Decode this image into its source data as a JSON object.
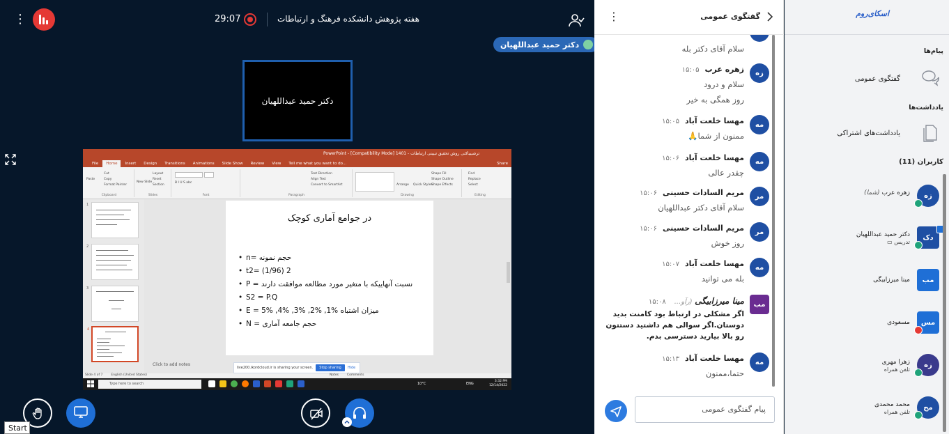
{
  "stage": {
    "timer": "29:07",
    "meeting_title": "هفته پژوهش دانشکده فرهنگ و ارتباطات",
    "speaker_pill": "دکتر حمید عبداللهیان",
    "camera_tile_name": "دکتر حمید عبداللهیان",
    "tooltip": "Start",
    "colors": {
      "background": "#06172a",
      "accent_red": "#e53935",
      "accent_blue": "#1f6fd6"
    }
  },
  "screen_share": {
    "ppt_title": "ترشیبیاکنی روش تحقیق تبیینی ارتباطات - 1401 [Compatibility Mode] - PowerPoint",
    "tabs": [
      "File",
      "Home",
      "Insert",
      "Design",
      "Transitions",
      "Animations",
      "Slide Show",
      "Review",
      "View",
      "Tell me what you want to do..."
    ],
    "share_label": "Share",
    "ribbon": {
      "clipboard": [
        "Cut",
        "Copy",
        "Format Painter",
        "Paste"
      ],
      "slides": [
        "New Slide",
        "Layout",
        "Reset",
        "Section"
      ],
      "group_labels": [
        "Clipboard",
        "Slides",
        "Font",
        "Paragraph",
        "Drawing",
        "Editing"
      ],
      "paragraph_items": [
        "Text Direction",
        "Align Text",
        "Convert to SmartArt"
      ],
      "drawing_items": [
        "Arrange",
        "Quick Styles",
        "Shape Fill",
        "Shape Outline",
        "Shape Effects"
      ],
      "editing_items": [
        "Find",
        "Replace",
        "Select"
      ]
    },
    "slide_numbers": [
      "1",
      "2",
      "3",
      "4"
    ],
    "slide": {
      "title": "در جوامع آماری کوچک",
      "bullets": [
        "n= حجم نمونه",
        "t2= (1/96) 2",
        "P = نسبت آنهاییکه با متغیر مورد مطالعه موافقت دارند",
        "S2 = P.Q",
        "E = میزان اشتباه %1, %2, %3, %4, %5",
        "N = حجم جامعه آماری"
      ]
    },
    "notes_placeholder": "Click to add notes",
    "sharing_bar": {
      "text": "live200.ikordcloud.ir is sharing your screen.",
      "stop_label": "Stop sharing",
      "hide_label": "Hide"
    },
    "status_bar": {
      "slide_info": "Slide 4 of 7",
      "language": "English (United States)",
      "notes": "Notes",
      "comments": "Comments"
    },
    "taskbar": {
      "search_placeholder": "Type here to search",
      "temperature": "10°C",
      "lang": "ENG",
      "time": "3:32 PM",
      "date": "12/14/2022"
    }
  },
  "chat": {
    "title": "گفتگوی عمومی",
    "messages": [
      {
        "initials": "",
        "name": "",
        "time": "",
        "lines": [
          "سلام آقای دکتر بله"
        ]
      },
      {
        "initials": "زه",
        "name": "زهره عرب",
        "time": "۱۵:۰۵",
        "lines": [
          "سلام و درود",
          "روز همگی به خیر"
        ]
      },
      {
        "initials": "مه",
        "name": "مهسا خلعت آباد",
        "time": "۱۵:۰۵",
        "lines": [
          "ممنون از شما🙏"
        ]
      },
      {
        "initials": "مه",
        "name": "مهسا خلعت آباد",
        "time": "۱۵:۰۶",
        "lines": [
          "چقدر عالی"
        ]
      },
      {
        "initials": "مر",
        "name": "مریم السادات حسینی",
        "time": "۱۵:۰۶",
        "lines": [
          "سلام آقای دکتر عبداللهیان"
        ]
      },
      {
        "initials": "مر",
        "name": "مریم السادات حسینی",
        "time": "۱۵:۰۶",
        "lines": [
          "روز خوش"
        ]
      },
      {
        "initials": "مه",
        "name": "مهسا خلعت آباد",
        "time": "۱۵:۰۷",
        "lines": [
          "بله می توانید"
        ]
      },
      {
        "initials": "مب",
        "name": "مینا میرزابیگی",
        "role": "(رآو...",
        "time": "۱۵:۰۸",
        "lines": [
          "اگر مشکلی در ارتباط بود کامنت بدید",
          "دوستان.اگر سوالی هم داشتید دستتون",
          "رو بالا بیارید دسترسی بدم."
        ]
      },
      {
        "initials": "مه",
        "name": "مهسا خلعت آباد",
        "time": "۱۵:۱۳",
        "lines": [
          "حتما،ممنون"
        ]
      }
    ],
    "input_placeholder": "پیام گفتگوی عمومی"
  },
  "sidebar": {
    "logo": "اسکای‌روم",
    "messages_header": "پیام‌ها",
    "public_chat": "گفتگوی عمومی",
    "notes_header": "یادداشت‌ها",
    "shared_notes": "یادداشت‌های اشتراکی",
    "users_header": "کاربران (11)",
    "users": [
      {
        "initials": "زه",
        "name": "زهره عرب",
        "sub": "(شما)",
        "color": "#1f4fa3",
        "badge": "#1fa37a"
      },
      {
        "initials": "دک",
        "name": "دکتر حمید عبداللهیان",
        "sub": "تدریس ▭",
        "color": "#1f4fa3",
        "badge": "#1fa37a"
      },
      {
        "initials": "مب",
        "name": "مینا میرزابیگی",
        "sub": "",
        "color": "#1f6fd6",
        "badge": ""
      },
      {
        "initials": "مس",
        "name": "مسعودی",
        "sub": "",
        "color": "#1f6fd6",
        "badge": "#e53935"
      },
      {
        "initials": "زه",
        "name": "زهرا مهری",
        "sub": "تلفن همراه",
        "color": "#3a3a8c",
        "badge": "#1fa37a"
      },
      {
        "initials": "مح",
        "name": "محمد محمدی",
        "sub": "تلفن همراه",
        "color": "#1f4fa3",
        "badge": "#1fa37a"
      }
    ]
  }
}
